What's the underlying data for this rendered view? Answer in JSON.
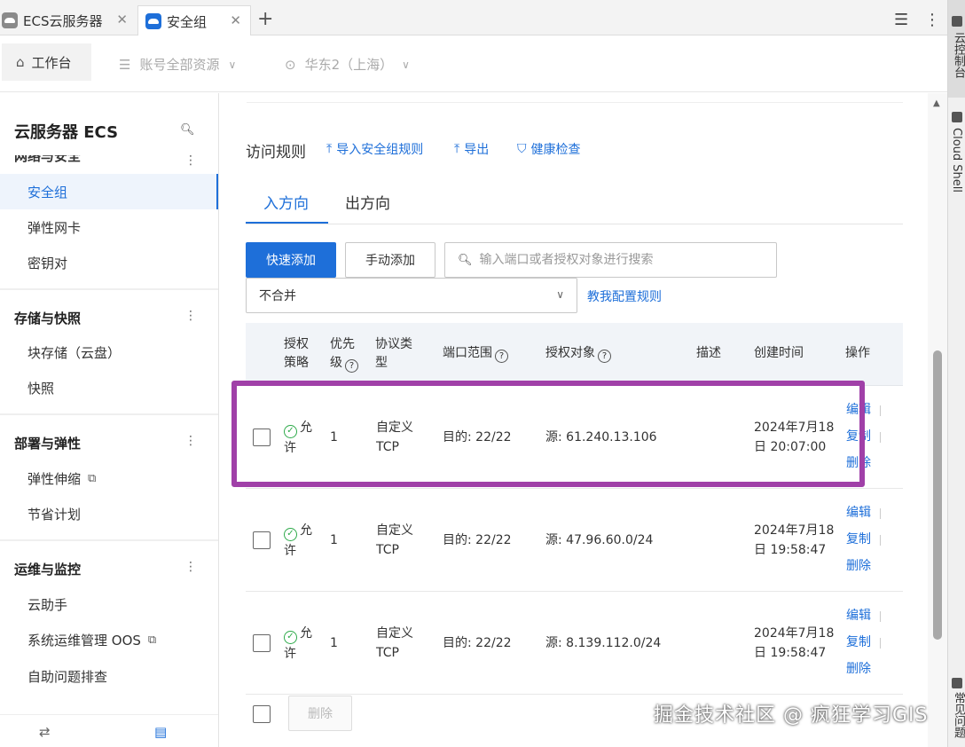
{
  "tabs": [
    {
      "label": "ECS云服务器"
    },
    {
      "label": "安全组"
    }
  ],
  "header": {
    "home": "工作台",
    "resource": "账号全部资源",
    "region": "华东2（上海）"
  },
  "sidebar": {
    "title": "云服务器 ECS",
    "cut_group": "网络与安全",
    "net_items": [
      "安全组",
      "弹性网卡",
      "密钥对"
    ],
    "groups": [
      {
        "title": "存储与快照",
        "items": [
          "块存储（云盘）",
          "快照"
        ]
      },
      {
        "title": "部署与弹性",
        "items": [
          "弹性伸缩",
          "节省计划"
        ]
      },
      {
        "title": "运维与监控",
        "items": [
          "云助手",
          "系统运维管理 OOS",
          "自助问题排查"
        ]
      }
    ]
  },
  "main": {
    "section_title": "访问规则",
    "links": [
      "导入安全组规则",
      "导出",
      "健康检查"
    ],
    "direction_tabs": [
      "入方向",
      "出方向"
    ],
    "quick_add": "快速添加",
    "manual_add": "手动添加",
    "search_placeholder": "输入端口或者授权对象进行搜索",
    "merge_select": "不合并",
    "help_link": "教我配置规则",
    "table": {
      "headers": {
        "policy_1": "授权",
        "policy_2": "策略",
        "priority_1": "优先",
        "priority_2": "级",
        "protocol_1": "协议类",
        "protocol_2": "型",
        "port": "端口范围",
        "auth": "授权对象",
        "desc": "描述",
        "created": "创建时间",
        "ops": "操作"
      },
      "rows": [
        {
          "policy_1": "允",
          "policy_2": "许",
          "priority": "1",
          "protocol_1": "自定义",
          "protocol_2": "TCP",
          "port": "目的: 22/22",
          "auth": "源: 61.240.13.106",
          "created_1": "2024年7月18",
          "created_2": "日 20:07:00"
        },
        {
          "policy_1": "允",
          "policy_2": "许",
          "priority": "1",
          "protocol_1": "自定义",
          "protocol_2": "TCP",
          "port": "目的: 22/22",
          "auth": "源: 47.96.60.0/24",
          "created_1": "2024年7月18",
          "created_2": "日 19:58:47"
        },
        {
          "policy_1": "允",
          "policy_2": "许",
          "priority": "1",
          "protocol_1": "自定义",
          "protocol_2": "TCP",
          "port": "目的: 22/22",
          "auth": "源: 8.139.112.0/24",
          "created_1": "2024年7月18",
          "created_2": "日 19:58:47"
        }
      ],
      "op_labels": [
        "编辑",
        "复制",
        "删除"
      ]
    },
    "delete_button": "删除"
  },
  "rail": {
    "console": "云控制台",
    "cloud_shell": "Cloud Shell",
    "faq": "常见问题"
  },
  "watermark": "掘金技术社区 @ 疯狂学习GIS"
}
